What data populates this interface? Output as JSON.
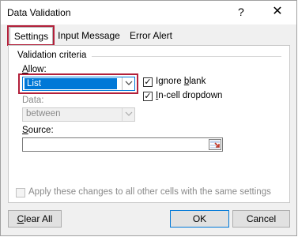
{
  "window": {
    "title": "Data Validation",
    "help_glyph": "?",
    "close_glyph": "✕"
  },
  "tabs": [
    {
      "label": "Settings",
      "active": true
    },
    {
      "label": "Input Message",
      "active": false
    },
    {
      "label": "Error Alert",
      "active": false
    }
  ],
  "criteria": {
    "group_label": "Validation criteria",
    "allow_label_prefix": "",
    "allow_label_key": "A",
    "allow_label_rest": "llow:",
    "allow_value": "List",
    "data_label": "Data:",
    "data_value": "between",
    "source_label_key": "S",
    "source_label_rest": "ource:",
    "source_value": ""
  },
  "options": {
    "ignore_blank": {
      "pre": "Ignore ",
      "key": "b",
      "post": "lank",
      "checked": true
    },
    "in_cell_dropdown": {
      "pre": "",
      "key": "I",
      "post": "n-cell dropdown",
      "checked": true
    },
    "apply_all": {
      "label": "Apply these changes to all other cells with the same settings",
      "checked": false,
      "disabled": true
    }
  },
  "buttons": {
    "clear_key": "C",
    "clear_rest": "lear All",
    "ok": "OK",
    "cancel": "Cancel"
  },
  "icons": {
    "dropdown": "chevron-down-icon",
    "check": "✓",
    "collapse": "range-select-icon"
  },
  "colors": {
    "highlight": "#b2203a",
    "selection": "#0078d7"
  }
}
